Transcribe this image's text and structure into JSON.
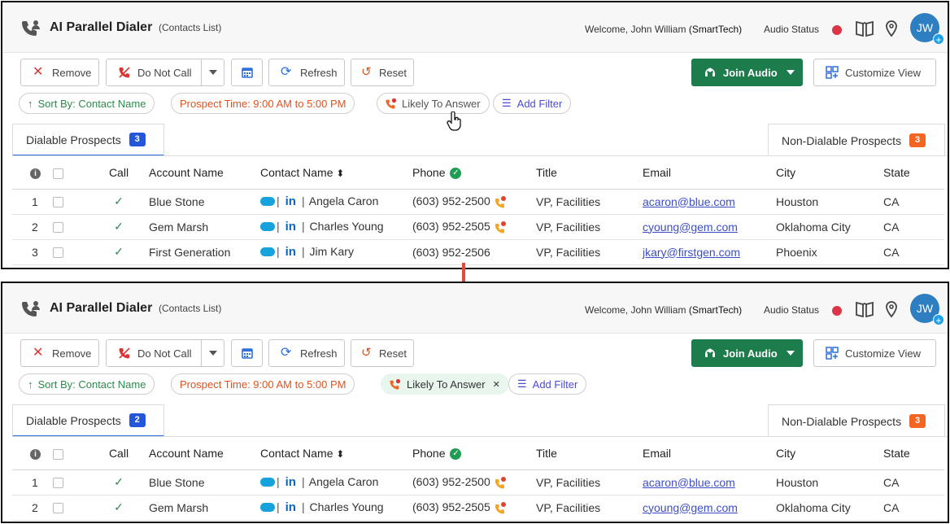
{
  "app": {
    "title": "AI Parallel Dialer",
    "subtitle": "(Contacts List)",
    "welcome_prefix": "Welcome, John William",
    "welcome_org": "(SmartTech)",
    "audio_status_label": "Audio Status",
    "avatar_initials": "JW",
    "avatar_badge": "+"
  },
  "toolbar": {
    "remove": "Remove",
    "do_not_call": "Do Not Call",
    "refresh": "Refresh",
    "reset": "Reset",
    "join_audio": "Join Audio",
    "customize_view": "Customize View"
  },
  "filters": {
    "sort": "Sort By: Contact Name",
    "prospect_time": "Prospect Time: 9:00 AM to 5:00 PM",
    "likely": "Likely To Answer",
    "remove_x": "✕",
    "add_filter": "Add Filter"
  },
  "tabs": {
    "dialable": "Dialable Prospects",
    "non_dialable": "Non-Dialable Prospects"
  },
  "columns": {
    "info": "i",
    "call": "Call",
    "account": "Account Name",
    "contact": "Contact Name",
    "sort_glyph": "⬍",
    "phone": "Phone",
    "title": "Title",
    "email": "Email",
    "city": "City",
    "state": "State"
  },
  "panel_top": {
    "dialable_count": "3",
    "non_dialable_count": "3",
    "rows": [
      {
        "num": "1",
        "account": "Blue Stone",
        "contact": "Angela Caron",
        "phone": "(603) 952-2500",
        "title": "VP, Facilities",
        "email": "acaron@blue.com",
        "city": "Houston",
        "state": "CA"
      },
      {
        "num": "2",
        "account": "Gem Marsh",
        "contact": "Charles Young",
        "phone": "(603) 952-2505",
        "title": "VP, Facilities",
        "email": "cyoung@gem.com",
        "city": "Oklahoma City",
        "state": "CA"
      },
      {
        "num": "3",
        "account": "First Generation",
        "contact": "Jim Kary",
        "phone": "(603) 952-2506",
        "title": "VP, Facilities",
        "email": "jkary@firstgen.com",
        "city": "Phoenix",
        "state": "CA"
      }
    ]
  },
  "panel_bottom": {
    "dialable_count": "2",
    "non_dialable_count": "3",
    "rows": [
      {
        "num": "1",
        "account": "Blue Stone",
        "contact": "Angela Caron",
        "phone": "(603) 952-2500",
        "title": "VP, Facilities",
        "email": "acaron@blue.com",
        "city": "Houston",
        "state": "CA"
      },
      {
        "num": "2",
        "account": "Gem Marsh",
        "contact": "Charles Young",
        "phone": "(603) 952-2505",
        "title": "VP, Facilities",
        "email": "cyoung@gem.com",
        "city": "Oklahoma City",
        "state": "CA"
      }
    ]
  },
  "colors": {
    "brand_green": "#1c7c4c",
    "accent_blue": "#2356d8",
    "orange": "#f26522",
    "arrow_red": "#e04a3f"
  }
}
